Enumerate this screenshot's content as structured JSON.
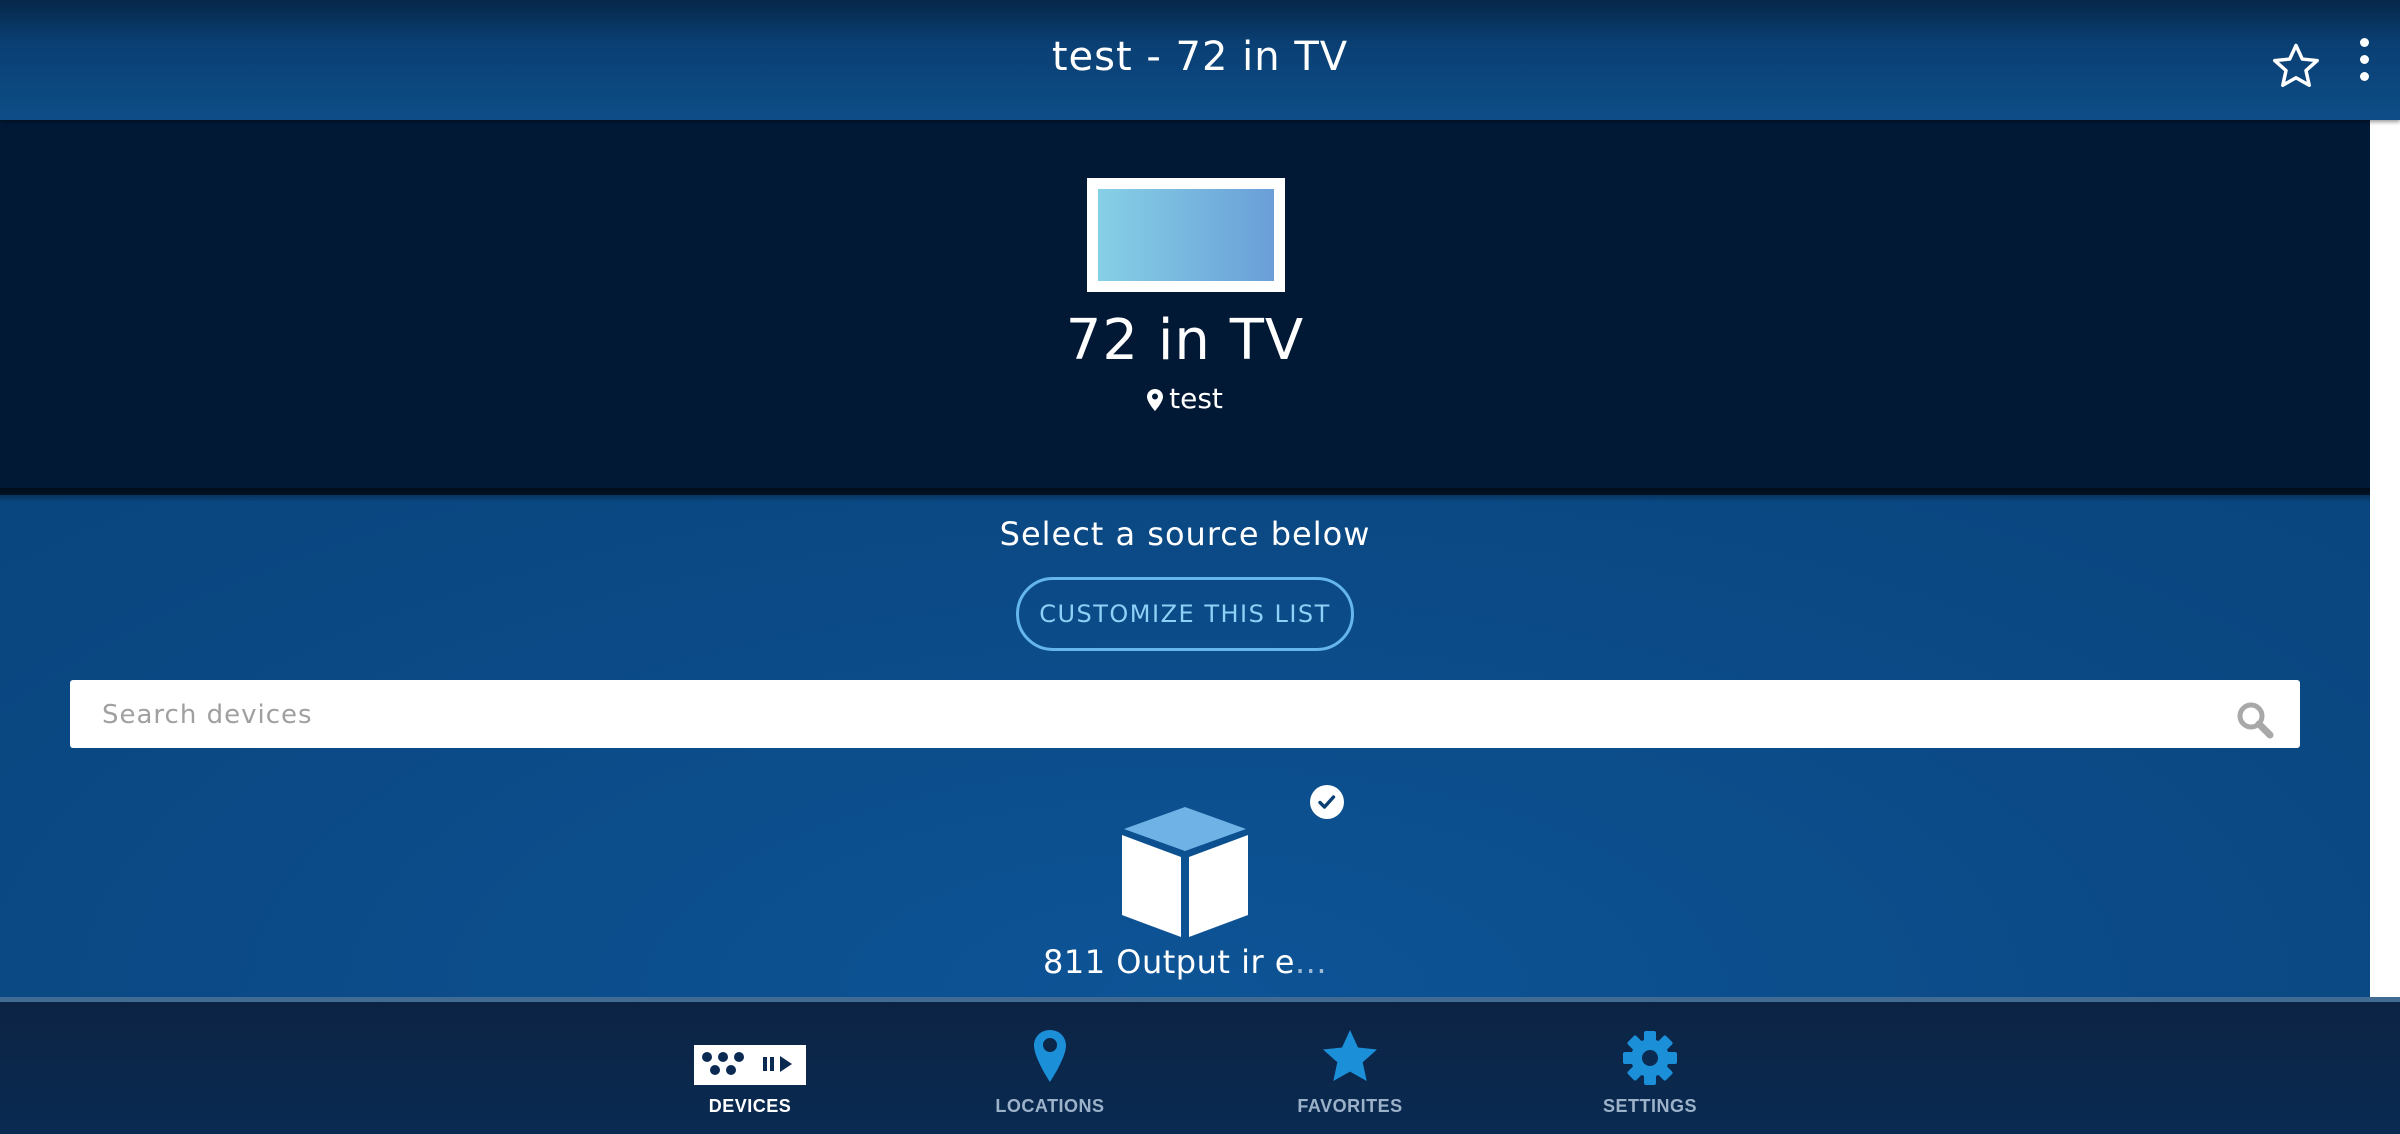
{
  "header": {
    "title": "test - 72 in TV"
  },
  "device": {
    "name": "72 in TV",
    "location": "test"
  },
  "sources": {
    "prompt": "Select a source below",
    "customize_label": "CUSTOMIZE THIS LIST",
    "search_placeholder": "Search devices",
    "items": [
      {
        "label_main": "811 Output ir e",
        "label_fade": "...",
        "selected": true,
        "icon": "cube-icon"
      }
    ]
  },
  "nav": {
    "items": [
      {
        "label": "DEVICES",
        "icon": "remote-icon",
        "active": true
      },
      {
        "label": "LOCATIONS",
        "icon": "location-pin-icon",
        "active": false
      },
      {
        "label": "FAVORITES",
        "icon": "star-icon",
        "active": false
      },
      {
        "label": "SETTINGS",
        "icon": "gear-icon",
        "active": false
      }
    ]
  },
  "colors": {
    "header": "#0a3f73",
    "hero_bg": "#021936",
    "main_bg": "#0b4a86",
    "accent": "#64b6ec",
    "nav_icon": "#1b8fd8"
  }
}
